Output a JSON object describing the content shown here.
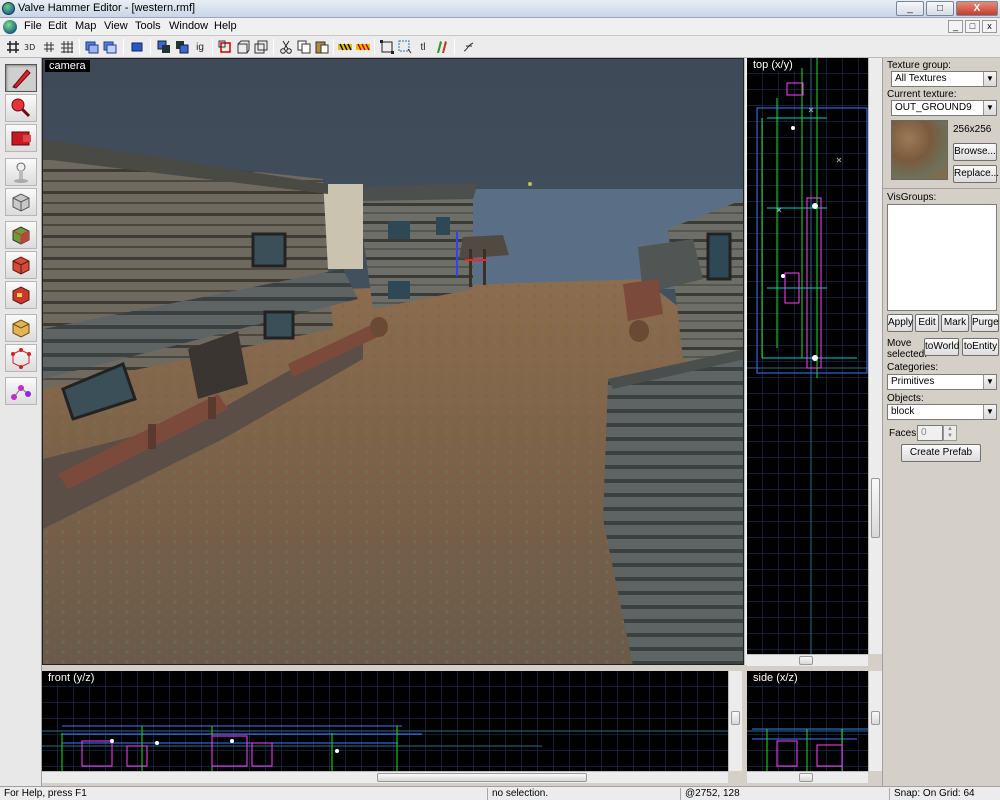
{
  "window": {
    "title": "Valve Hammer Editor - [western.rmf]",
    "min": "_",
    "max": "□",
    "close": "X"
  },
  "menu": {
    "items": [
      "File",
      "Edit",
      "Map",
      "View",
      "Tools",
      "Window",
      "Help"
    ],
    "mdi": [
      "_",
      "□",
      "x"
    ]
  },
  "toolbar": {
    "ig_label": "ig",
    "tl_label": "tl"
  },
  "viewports": {
    "camera": "camera",
    "top": "top (x/y)",
    "front": "front (y/z)",
    "side": "side (x/z)"
  },
  "panel": {
    "texture_group_label": "Texture group:",
    "texture_group_value": "All Textures",
    "current_texture_label": "Current texture:",
    "current_texture_value": "OUT_GROUND9",
    "texture_size": "256x256",
    "browse": "Browse...",
    "replace": "Replace...",
    "visgroups_label": "VisGroups:",
    "apply": "Apply",
    "edit": "Edit",
    "mark": "Mark",
    "purge": "Purge",
    "move_selected": "Move selected:",
    "to_world": "toWorld",
    "to_entity": "toEntity",
    "categories_label": "Categories:",
    "categories_value": "Primitives",
    "objects_label": "Objects:",
    "objects_value": "block",
    "faces_label": "Faces:",
    "faces_value": "0",
    "create_prefab": "Create Prefab"
  },
  "status": {
    "help": "For Help, press F1",
    "selection": "no selection.",
    "coords": "@2752, 128",
    "snap": "Snap: On Grid: 64"
  }
}
